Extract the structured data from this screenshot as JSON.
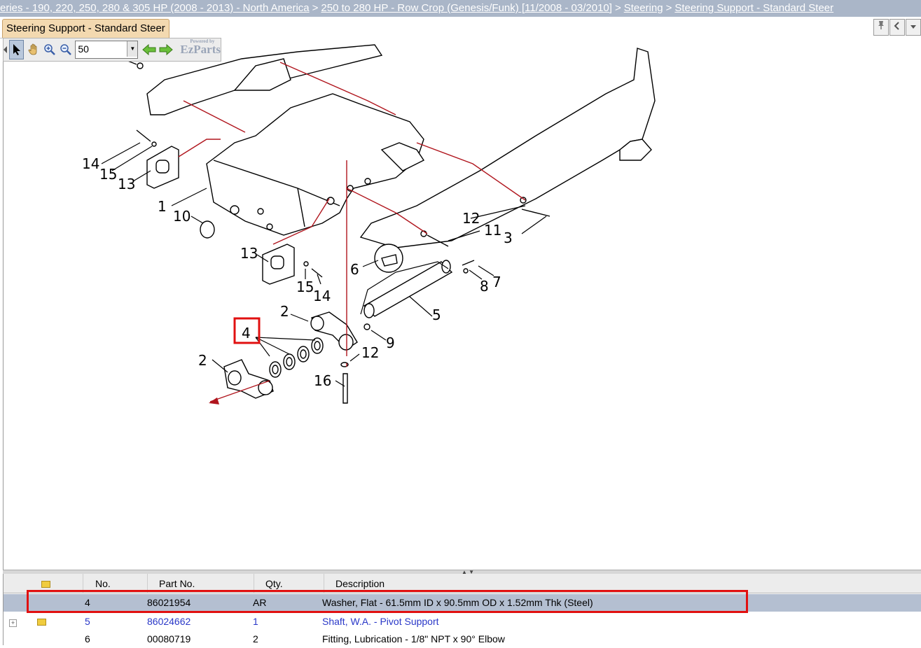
{
  "breadcrumb": {
    "items": [
      "eries - 190, 220, 250, 280 & 305 HP (2008 - 2013) - North America",
      "250 to 280 HP - Row Crop (Genesis/Funk) [11/2008 - 03/2010]",
      "Steering",
      "Steering Support - Standard Steer"
    ],
    "separator": ">"
  },
  "tab": {
    "label": "Steering Support - Standard Steer"
  },
  "toolbar": {
    "zoom_value": "50",
    "logo_text": "EzParts",
    "logo_sub": "Powered by"
  },
  "diagram": {
    "callouts": [
      "14",
      "15",
      "13",
      "1",
      "10",
      "13",
      "15",
      "14",
      "2",
      "2",
      "4",
      "6",
      "12",
      "11",
      "3",
      "8",
      "7",
      "5",
      "9",
      "12",
      "16"
    ],
    "highlighted_callout": "4"
  },
  "parts_table": {
    "columns": [
      "",
      "No.",
      "Part No.",
      "Qty.",
      "Description"
    ],
    "rows": [
      {
        "no": "4",
        "part_no": "86021954",
        "qty": "AR",
        "description": "Washer, Flat - 61.5mm ID x 90.5mm OD x 1.52mm Thk (Steel)",
        "selected": true
      },
      {
        "no": "5",
        "part_no": "86024662",
        "qty": "1",
        "description": "Shaft, W.A. - Pivot Support",
        "selected": false
      },
      {
        "no": "6",
        "part_no": "00080719",
        "qty": "2",
        "description": "Fitting, Lubrication - 1/8\" NPT x 90° Elbow",
        "selected": false
      }
    ]
  },
  "colors": {
    "accent_red": "#e11010",
    "selected_row": "#b4bfd1",
    "link_blue": "#2a38c8",
    "tab_bg": "#f3d9b0",
    "breadcrumb_bg": "#aab6c8"
  }
}
